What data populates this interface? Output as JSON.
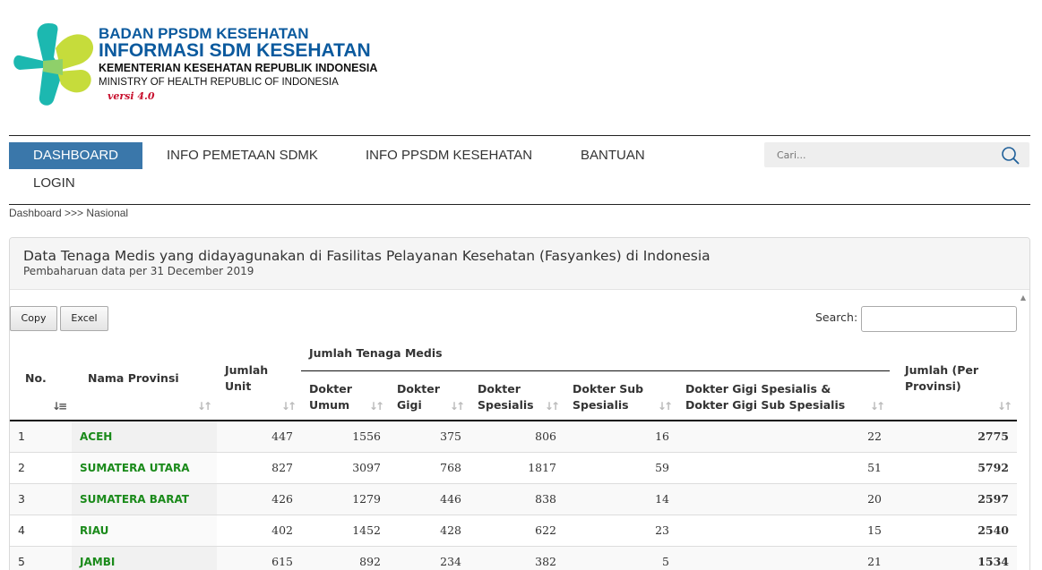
{
  "header": {
    "line1": "BADAN PPSDM KESEHATAN",
    "line2": "INFORMASI SDM KESEHATAN",
    "line3": "KEMENTERIAN KESEHATAN REPUBLIK INDONESIA",
    "line4": "MINISTRY OF HEALTH REPUBLIC OF INDONESIA",
    "version": "versi 4.0"
  },
  "nav": {
    "items": [
      "DASHBOARD",
      "INFO PEMETAAN SDMK",
      "INFO PPSDM KESEHATAN",
      "BANTUAN",
      "LOGIN"
    ],
    "search_placeholder": "Cari..."
  },
  "breadcrumb": "Dashboard >>> Nasional",
  "panel": {
    "title": "Data Tenaga Medis yang didayagunakan di Fasilitas Pelayanan Kesehatan (Fasyankes) di Indonesia",
    "subtitle": "Pembaharuan data per 31 December 2019"
  },
  "toolbar": {
    "copy_label": "Copy",
    "excel_label": "Excel",
    "search_label": "Search:"
  },
  "table": {
    "group_header": "Jumlah Tenaga Medis",
    "headers": {
      "no": "No.",
      "provinsi": "Nama Provinsi",
      "unit": "Jumlah Unit",
      "umum": "Dokter Umum",
      "gigi": "Dokter Gigi",
      "spesialis": "Dokter Spesialis",
      "subspesialis": "Dokter Sub Spesialis",
      "gigisp": "Dokter Gigi Spesialis & Dokter Gigi Sub Spesialis",
      "total": "Jumlah (Per Provinsi)"
    },
    "rows": [
      {
        "no": "1",
        "prov": "ACEH",
        "unit": "447",
        "umum": "1556",
        "gigi": "375",
        "sp": "806",
        "subsp": "16",
        "gigisp": "22",
        "total": "2775"
      },
      {
        "no": "2",
        "prov": "SUMATERA UTARA",
        "unit": "827",
        "umum": "3097",
        "gigi": "768",
        "sp": "1817",
        "subsp": "59",
        "gigisp": "51",
        "total": "5792"
      },
      {
        "no": "3",
        "prov": "SUMATERA BARAT",
        "unit": "426",
        "umum": "1279",
        "gigi": "446",
        "sp": "838",
        "subsp": "14",
        "gigisp": "20",
        "total": "2597"
      },
      {
        "no": "4",
        "prov": "RIAU",
        "unit": "402",
        "umum": "1452",
        "gigi": "428",
        "sp": "622",
        "subsp": "23",
        "gigisp": "15",
        "total": "2540"
      },
      {
        "no": "5",
        "prov": "JAMBI",
        "unit": "615",
        "umum": "892",
        "gigi": "234",
        "sp": "382",
        "subsp": "5",
        "gigisp": "21",
        "total": "1534"
      }
    ]
  }
}
